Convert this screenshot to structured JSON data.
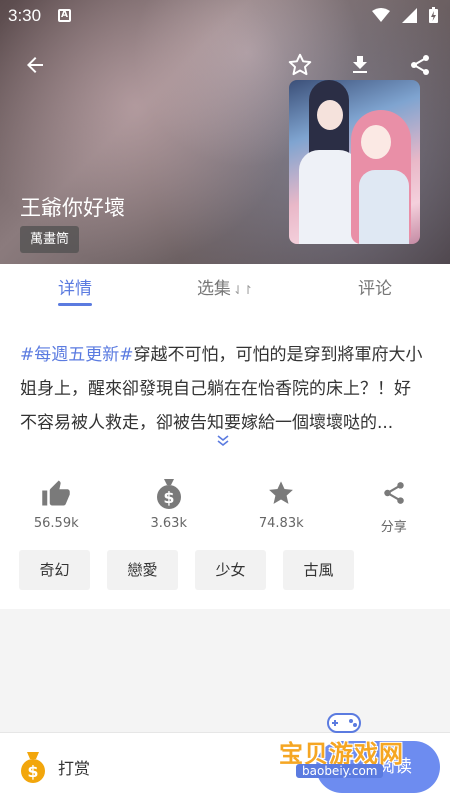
{
  "status_bar": {
    "time": "3:30",
    "notification_letter": "A"
  },
  "header": {
    "title": "王爺你好壞",
    "badge": "萬畫筒",
    "icons": [
      "back-arrow-icon",
      "star-outline-icon",
      "download-icon",
      "share-icon"
    ]
  },
  "tabs": [
    {
      "label": "详情",
      "active": true
    },
    {
      "label": "选集",
      "active": false
    },
    {
      "label": "评论",
      "active": false
    }
  ],
  "description": {
    "tag": "#每週五更新#",
    "text": "穿越不可怕，可怕的是穿到將軍府大小姐身上，醒來卻發現自己躺在在怡香院的床上？！好不容易被人救走，卻被告知要嫁給一個壞壞哒的..."
  },
  "stats": [
    {
      "icon": "thumbs-up-icon",
      "label": "56.59k"
    },
    {
      "icon": "money-bag-icon",
      "label": "3.63k"
    },
    {
      "icon": "star-icon",
      "label": "74.83k"
    },
    {
      "icon": "share-icon",
      "label": "分享"
    }
  ],
  "genres": [
    "奇幻",
    "戀愛",
    "少女",
    "古風"
  ],
  "bottom_bar": {
    "reward_label": "打赏",
    "read_label": "开始阅读"
  },
  "watermark": {
    "title": "宝贝游戏网",
    "url": "baobeiy.com"
  },
  "colors": {
    "accent": "#5b7be0",
    "read_button": "#6d8cf0",
    "reward_gold": "#f2a60c"
  }
}
